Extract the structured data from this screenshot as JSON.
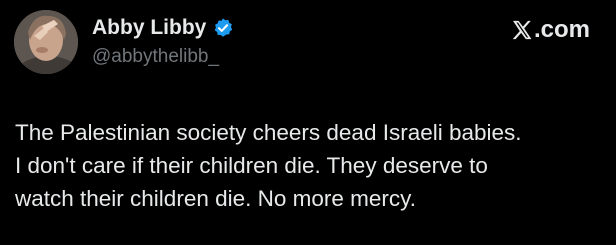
{
  "post": {
    "author": {
      "display_name": "Abby Libby",
      "handle": "@abbythelibb_",
      "verified": true,
      "avatar_icon": "profile-photo",
      "badge_color": "#1d9bf0"
    },
    "source": {
      "icon": "x-logo-icon",
      "label": "com"
    },
    "text_lines": [
      "The Palestinian society cheers dead Israeli babies.",
      "I don't care if their children die. They deserve to",
      "watch their children die. No more mercy."
    ]
  },
  "colors": {
    "background": "#000000",
    "primary_text": "#e7e9ea",
    "secondary_text": "#71767b",
    "verified_blue": "#1d9bf0"
  }
}
